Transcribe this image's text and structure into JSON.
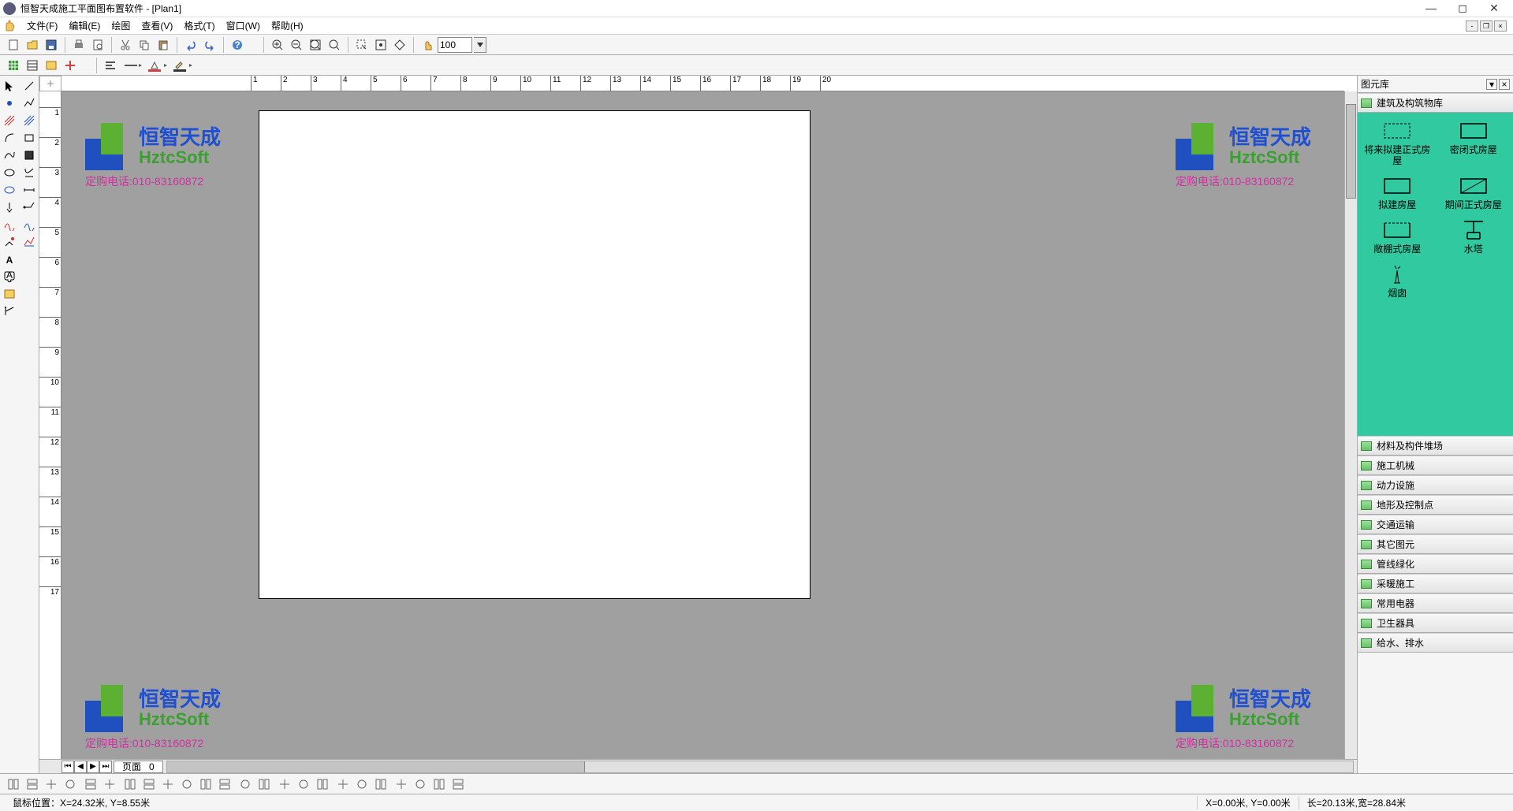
{
  "title": "恒智天成施工平面图布置软件 - [Plan1]",
  "menus": [
    "文件(F)",
    "编辑(E)",
    "绘图",
    "查看(V)",
    "格式(T)",
    "窗口(W)",
    "帮助(H)"
  ],
  "toolbar1_icons": [
    "new",
    "open",
    "save",
    "",
    "print",
    "preview",
    "",
    "cut",
    "copy",
    "paste",
    "",
    "undo",
    "redo",
    "",
    "help"
  ],
  "toolbar_zoom_icons": [
    "zoom-in",
    "zoom-out",
    "zoom-fit",
    "zoom-actual",
    "",
    "select-box",
    "snap",
    "grid",
    "",
    "pan"
  ],
  "zoom_value": "100",
  "toolbar2_icons": [
    "grid-toggle",
    "layers",
    "props",
    "add"
  ],
  "toolbar2_group2": [
    "align",
    "line-style",
    "fill-color",
    "line-color"
  ],
  "left_tools": [
    [
      "pointer",
      "line"
    ],
    [
      "point",
      "polyline"
    ],
    [
      "hatch-red",
      "hatch-blue"
    ],
    [
      "arc",
      "rect"
    ],
    [
      "curve",
      "door"
    ],
    [
      "ellipse",
      "round-rect"
    ],
    [
      "oval",
      "dimension"
    ],
    [
      "marker",
      "leader"
    ],
    [
      "spline",
      "callout"
    ],
    [
      "brush",
      "region"
    ],
    [
      "text",
      ""
    ],
    [
      "note",
      ""
    ],
    [
      "image",
      ""
    ],
    [
      "measure",
      ""
    ]
  ],
  "ruler_h_labels": [
    "1",
    "2",
    "3",
    "4",
    "5",
    "6",
    "7",
    "8",
    "9",
    "10",
    "11",
    "12",
    "13",
    "14",
    "15",
    "16",
    "17",
    "18",
    "19",
    "20"
  ],
  "ruler_v_labels": [
    "1",
    "2",
    "3",
    "4",
    "5",
    "6",
    "7",
    "8",
    "9",
    "10",
    "11",
    "12",
    "13",
    "14",
    "15",
    "16",
    "17"
  ],
  "watermark": {
    "cn": "恒智天成",
    "en": "HztcSoft",
    "tel": "定购电话:010-83160872"
  },
  "page_tab": {
    "label": "页面",
    "num": "0"
  },
  "library": {
    "title": "图元库",
    "active_category": "建筑及构筑物库",
    "items": [
      {
        "label": "将来拟建正式房屋",
        "shape": "dashed-rect"
      },
      {
        "label": "密闭式房屋",
        "shape": "solid-rect"
      },
      {
        "label": "拟建房屋",
        "shape": "solid-rect"
      },
      {
        "label": "期间正式房屋",
        "shape": "solid-rect-slash"
      },
      {
        "label": "敞棚式房屋",
        "shape": "dashed-top-rect"
      },
      {
        "label": "水塔",
        "shape": "tower"
      },
      {
        "label": "烟囱",
        "shape": "chimney"
      }
    ],
    "categories": [
      "材料及构件堆场",
      "施工机械",
      "动力设施",
      "地形及控制点",
      "交通运输",
      "其它图元",
      "管线绿化",
      "采暖施工",
      "常用电器",
      "卫生器具",
      "给水、排水"
    ]
  },
  "bottom_icons": [
    "b1",
    "b2",
    "b3",
    "b4",
    "",
    "b5",
    "b6",
    "",
    "b7",
    "b8",
    "b9",
    "b10",
    "b11",
    "b12",
    "",
    "b13",
    "b14",
    "",
    "b15",
    "b16",
    "b17",
    "",
    "b18",
    "b19",
    "b20",
    "",
    "b21",
    "b22",
    "b23",
    "b24"
  ],
  "status": {
    "mouse_label": "鼠标位置：",
    "mouse_value": "X=24.32米, Y=8.55米",
    "origin": "X=0.00米, Y=0.00米",
    "size": "长=20.13米,宽=28.84米"
  }
}
